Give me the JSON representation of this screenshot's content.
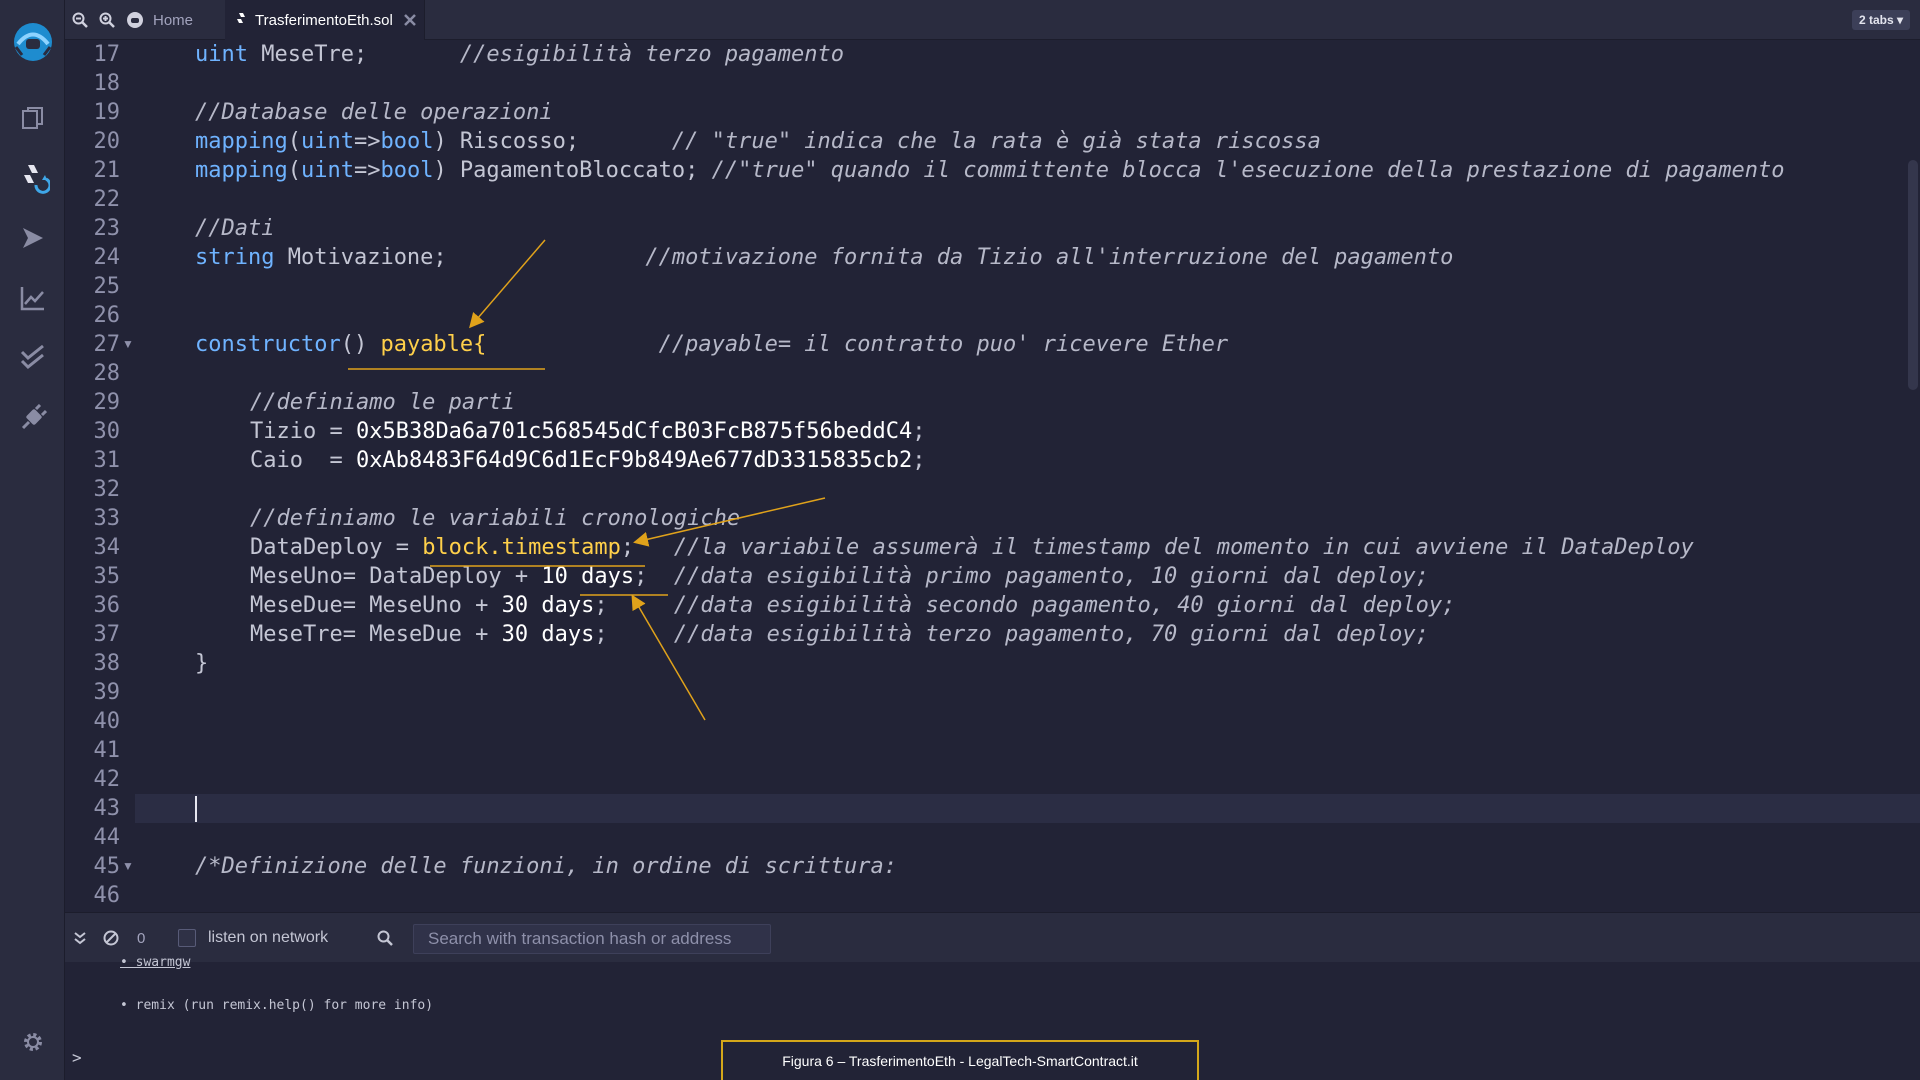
{
  "tabbar": {
    "home_label": "Home",
    "file_tab_label": "TrasferimentoEth.sol",
    "tabs_menu_label": "2 tabs ▾"
  },
  "editor": {
    "line_numbers": [
      "17",
      "18",
      "19",
      "20",
      "21",
      "22",
      "23",
      "24",
      "25",
      "26",
      "27",
      "28",
      "29",
      "30",
      "31",
      "32",
      "33",
      "34",
      "35",
      "36",
      "37",
      "38",
      "39",
      "40",
      "41",
      "42",
      "43",
      "44",
      "45",
      "46"
    ],
    "lines": {
      "l17": {
        "kw": "uint",
        "name": " MeseTre;",
        "pad": "       ",
        "cm": "//esigibilità terzo pagamento"
      },
      "l19": {
        "cm": "//Database delle operazioni"
      },
      "l20": {
        "fn": "mapping",
        "a": "(",
        "k1": "uint",
        "b": "=>",
        "k2": "bool",
        "c": ") Riscosso;",
        "pad": "       ",
        "cm": "// \"true\" indica che la rata è già stata riscossa"
      },
      "l21": {
        "fn": "mapping",
        "a": "(",
        "k1": "uint",
        "b": "=>",
        "k2": "bool",
        "c": ") PagamentoBloccato;",
        "pad": " ",
        "cm": "//\"true\" quando il committente blocca l'esecuzione della prestazione di pagamento"
      },
      "l23": {
        "cm": "//Dati"
      },
      "l24": {
        "kw": "string",
        "name": " Motivazione;",
        "pad": "               ",
        "cm": "//motivazione fornita da Tizio all'interruzione del pagamento"
      },
      "l27": {
        "fn": "constructor",
        "a": "() ",
        "hl": "payable",
        "b": "{",
        "pad": "             ",
        "cm": "//payable= il contratto puo' ricevere Ether"
      },
      "l29": {
        "cm": "//definiamo le parti"
      },
      "l30": {
        "id": "Tizio = ",
        "num": "0x5B38Da6a701c568545dCfcB03FcB875f56beddC4",
        "end": ";"
      },
      "l31": {
        "id": "Caio  = ",
        "num": "0xAb8483F64d9C6d1EcF9b849Ae677dD3315835cb2",
        "end": ";"
      },
      "l33": {
        "cm": "//definiamo le variabili cronologiche"
      },
      "l34": {
        "id": "DataDeploy = ",
        "hl": "block.timestamp",
        "end": ";",
        "pad": "   ",
        "cm": "//la variabile assumerà il timestamp del momento in cui avviene il DataDeploy"
      },
      "l35": {
        "id": "MeseUno= DataDeploy + ",
        "num": "10 days",
        "end": ";",
        "pad": "  ",
        "cm": "//data esigibilità primo pagamento, 10 giorni dal deploy;"
      },
      "l36": {
        "id": "MeseDue= MeseUno + ",
        "num": "30 days",
        "end": ";",
        "pad": "     ",
        "cm": "//data esigibilità secondo pagamento, 40 giorni dal deploy;"
      },
      "l37": {
        "id": "MeseTre= MeseDue + ",
        "num": "30 days",
        "end": ";",
        "pad": "     ",
        "cm": "//data esigibilità terzo pagamento, 70 giorni dal deploy;"
      },
      "l38": {
        "id": "}"
      },
      "l45": {
        "cm": "/*Definizione delle funzioni, in ordine di scrittura:"
      }
    }
  },
  "terminal": {
    "pending_count": "0",
    "listen_label": "listen on network",
    "search_placeholder": "Search with transaction hash or address",
    "output_line_1": "• swarmgw",
    "output_line_2": "• remix (run remix.help() for more info)",
    "prompt": ">"
  },
  "caption": "Figura 6 – TrasferimentoEth - LegalTech-SmartContract.it",
  "colors": {
    "background": "#222336",
    "panel": "#2a2c3f",
    "keyword": "#6fb3ff",
    "highlight": "#ffd04a",
    "annotation_arrow": "#e0a21b"
  }
}
